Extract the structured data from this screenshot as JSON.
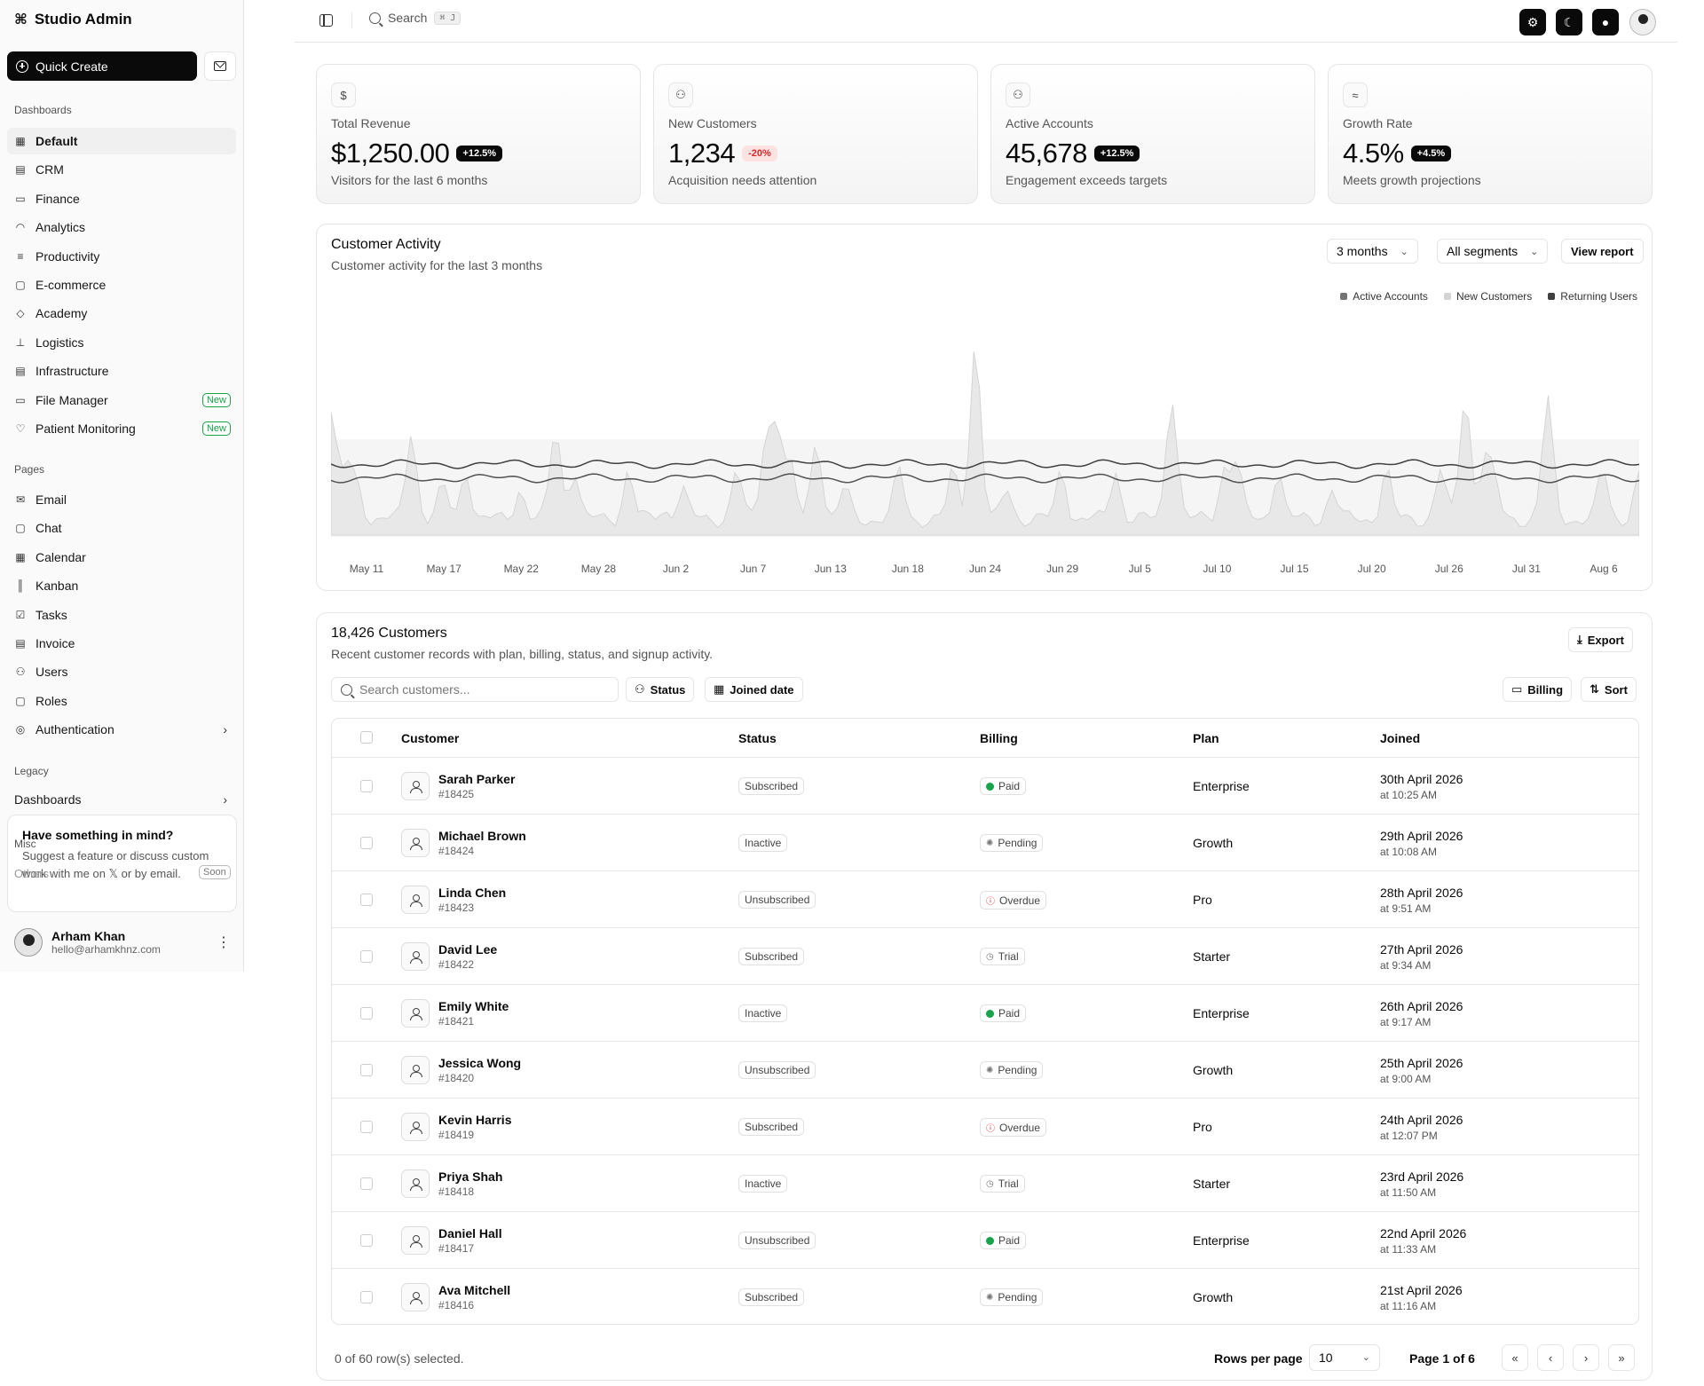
{
  "app": {
    "title": "Studio Admin"
  },
  "sidebar": {
    "quick_create": "Quick Create",
    "sections": {
      "dashboards": "Dashboards",
      "pages": "Pages",
      "legacy": "Legacy",
      "misc": "Misc"
    },
    "dashboards": [
      {
        "label": "Default",
        "icon": "grid-icon"
      },
      {
        "label": "CRM",
        "icon": "chart-icon"
      },
      {
        "label": "Finance",
        "icon": "banknote-icon"
      },
      {
        "label": "Analytics",
        "icon": "gauge-icon"
      },
      {
        "label": "Productivity",
        "icon": "checklist-icon"
      },
      {
        "label": "E-commerce",
        "icon": "shopping-bag-icon"
      },
      {
        "label": "Academy",
        "icon": "graduation-cap-icon"
      },
      {
        "label": "Logistics",
        "icon": "forklift-icon"
      },
      {
        "label": "Infrastructure",
        "icon": "server-icon"
      },
      {
        "label": "File Manager",
        "icon": "folder-icon",
        "badge": "New"
      },
      {
        "label": "Patient Monitoring",
        "icon": "heart-pulse-icon",
        "badge": "New"
      }
    ],
    "pages": [
      {
        "label": "Email",
        "icon": "mail-icon"
      },
      {
        "label": "Chat",
        "icon": "message-square-icon"
      },
      {
        "label": "Calendar",
        "icon": "calendar-icon"
      },
      {
        "label": "Kanban",
        "icon": "kanban-icon"
      },
      {
        "label": "Tasks",
        "icon": "square-check-icon"
      },
      {
        "label": "Invoice",
        "icon": "receipt-icon"
      },
      {
        "label": "Users",
        "icon": "users-icon"
      },
      {
        "label": "Roles",
        "icon": "lock-icon"
      },
      {
        "label": "Authentication",
        "icon": "fingerprint-icon"
      }
    ],
    "legacy_dashboards": "Dashboards",
    "others": "Others",
    "soon": "Soon",
    "card": {
      "title": "Have something in mind?",
      "text": "Suggest a feature or discuss custom work with me on 𝕏 or by email."
    },
    "user": {
      "name": "Arham Khan",
      "email": "hello@arhamkhnz.com"
    }
  },
  "header": {
    "search": "Search",
    "shortcut": "⌘ J"
  },
  "stats": [
    {
      "label": "Total Revenue",
      "value": "$1,250.00",
      "delta": "+12.5%",
      "sub": "Visitors for the last 6 months",
      "icon": "dollar-icon",
      "positive": true
    },
    {
      "label": "New Customers",
      "value": "1,234",
      "delta": "-20%",
      "sub": "Acquisition needs attention",
      "icon": "user-plus-icon",
      "positive": false
    },
    {
      "label": "Active Accounts",
      "value": "45,678",
      "delta": "+12.5%",
      "sub": "Engagement exceeds targets",
      "icon": "users-icon",
      "positive": true
    },
    {
      "label": "Growth Rate",
      "value": "4.5%",
      "delta": "+4.5%",
      "sub": "Meets growth projections",
      "icon": "waves-icon",
      "positive": true
    }
  ],
  "activity": {
    "title": "Customer Activity",
    "desc": "Customer activity for the last 3 months",
    "range": "3 months",
    "segment": "All segments",
    "view_report": "View report"
  },
  "chart_data": {
    "type": "area",
    "series": [
      {
        "name": "Active Accounts",
        "color": "#737373"
      },
      {
        "name": "New Customers",
        "color": "#d4d4d4"
      },
      {
        "name": "Returning Users",
        "color": "#404040"
      }
    ],
    "x_ticks": [
      "May 11",
      "May 17",
      "May 22",
      "May 28",
      "Jun 2",
      "Jun 7",
      "Jun 13",
      "Jun 18",
      "Jun 24",
      "Jun 29",
      "Jul 5",
      "Jul 10",
      "Jul 15",
      "Jul 20",
      "Jul 26",
      "Jul 31",
      "Aug 6"
    ],
    "grid": false,
    "legend": "top-right"
  },
  "customers": {
    "title": "18,426 Customers",
    "desc": "Recent customer records with plan, billing, status, and signup activity.",
    "export": "Export",
    "search_placeholder": "Search customers...",
    "filters": {
      "status": "Status",
      "joined": "Joined date",
      "billing": "Billing",
      "sort": "Sort"
    },
    "columns": [
      "Customer",
      "Status",
      "Billing",
      "Plan",
      "Joined"
    ],
    "rows": [
      {
        "name": "Sarah Parker",
        "id": "#18425",
        "status": "Subscribed",
        "billing": "Paid",
        "plan": "Enterprise",
        "date": "30th April 2026",
        "time": "at 10:25 AM"
      },
      {
        "name": "Michael Brown",
        "id": "#18424",
        "status": "Inactive",
        "billing": "Pending",
        "plan": "Growth",
        "date": "29th April 2026",
        "time": "at 10:08 AM"
      },
      {
        "name": "Linda Chen",
        "id": "#18423",
        "status": "Unsubscribed",
        "billing": "Overdue",
        "plan": "Pro",
        "date": "28th April 2026",
        "time": "at 9:51 AM"
      },
      {
        "name": "David Lee",
        "id": "#18422",
        "status": "Subscribed",
        "billing": "Trial",
        "plan": "Starter",
        "date": "27th April 2026",
        "time": "at 9:34 AM"
      },
      {
        "name": "Emily White",
        "id": "#18421",
        "status": "Inactive",
        "billing": "Paid",
        "plan": "Enterprise",
        "date": "26th April 2026",
        "time": "at 9:17 AM"
      },
      {
        "name": "Jessica Wong",
        "id": "#18420",
        "status": "Unsubscribed",
        "billing": "Pending",
        "plan": "Growth",
        "date": "25th April 2026",
        "time": "at 9:00 AM"
      },
      {
        "name": "Kevin Harris",
        "id": "#18419",
        "status": "Subscribed",
        "billing": "Overdue",
        "plan": "Pro",
        "date": "24th April 2026",
        "time": "at 12:07 PM"
      },
      {
        "name": "Priya Shah",
        "id": "#18418",
        "status": "Inactive",
        "billing": "Trial",
        "plan": "Starter",
        "date": "23rd April 2026",
        "time": "at 11:50 AM"
      },
      {
        "name": "Daniel Hall",
        "id": "#18417",
        "status": "Unsubscribed",
        "billing": "Paid",
        "plan": "Enterprise",
        "date": "22nd April 2026",
        "time": "at 11:33 AM"
      },
      {
        "name": "Ava Mitchell",
        "id": "#18416",
        "status": "Subscribed",
        "billing": "Pending",
        "plan": "Growth",
        "date": "21st April 2026",
        "time": "at 11:16 AM"
      }
    ],
    "selected": "0 of 60 row(s) selected.",
    "rows_per_page_label": "Rows per page",
    "rows_per_page": "10",
    "page_info": "Page 1 of 6"
  }
}
